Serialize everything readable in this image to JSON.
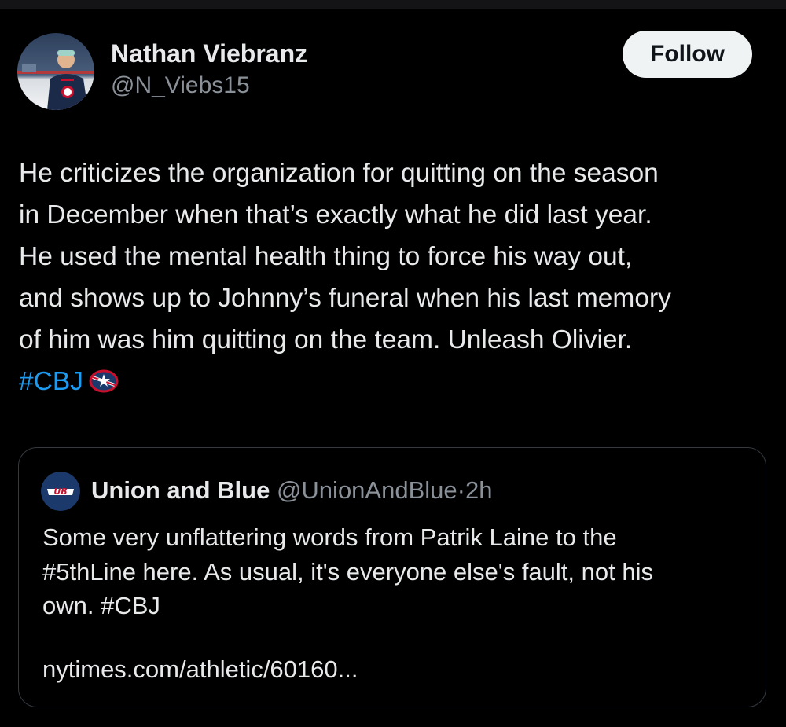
{
  "author": {
    "name": "Nathan Viebranz",
    "handle": "@N_Viebs15",
    "avatar_icon": "profile-photo"
  },
  "follow_button": {
    "label": "Follow"
  },
  "tweet": {
    "lines": [
      "He criticizes the organization for quitting on the season",
      "in December when that’s exactly what he did last year.",
      "He used the mental health thing to force his way out,",
      "and shows up to Johnny’s funeral when his last memory",
      "of him was him quitting on the team. Unleash Olivier."
    ],
    "hashtag": "#CBJ",
    "emoji_icon": "blue-jackets-logo-icon"
  },
  "quoted_tweet": {
    "name": "Union and Blue",
    "handle": "@UnionAndBlue",
    "separator": "·",
    "time": "2h",
    "avatar_icon": "union-and-blue-logo",
    "lines": [
      "Some very unflattering words from Patrik Laine to the",
      "#5thLine here. As usual, it's everyone else's fault, not his",
      "own. #CBJ"
    ],
    "link": "nytimes.com/athletic/60160..."
  },
  "colors": {
    "background": "#000000",
    "text": "#e7e9ea",
    "secondary_text": "#8b9199",
    "link": "#1d9bf0",
    "button_bg": "#eff3f4",
    "border": "#343a40"
  }
}
